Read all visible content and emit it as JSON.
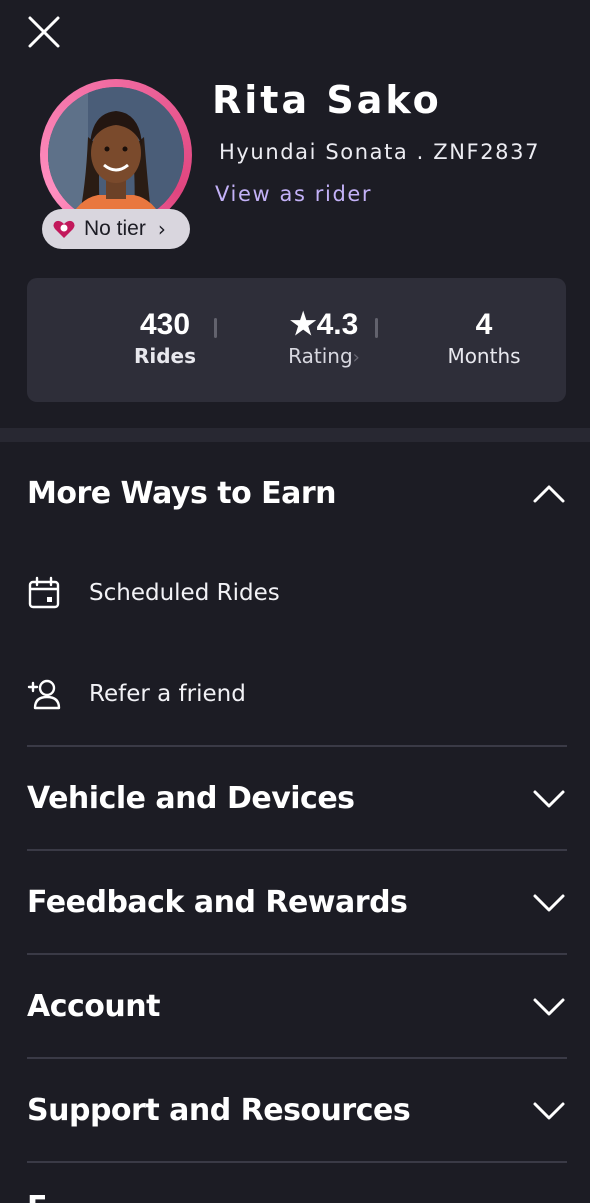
{
  "profile": {
    "name": "Rita Sako",
    "vehicle": "Hyundai Sonata . ZNF2837",
    "view_as_rider": "View as rider",
    "tier_label": "No tier",
    "tier_chevron": "›",
    "ring_color": "#f06aa0",
    "link_color": "#c3b1f7"
  },
  "stats": {
    "rides_value": "430",
    "rides_label": "Rides",
    "rating_value": "★4.3",
    "rating_label": "Rating",
    "rating_chevron": "›",
    "months_value": "4",
    "months_label": "Months"
  },
  "sections": {
    "more_ways": {
      "title": "More Ways to Earn",
      "expanded": true,
      "items": [
        {
          "label": "Scheduled Rides",
          "icon": "calendar-icon"
        },
        {
          "label": "Refer a friend",
          "icon": "add-person-icon"
        }
      ]
    },
    "vehicle_devices": {
      "title": "Vehicle and Devices",
      "expanded": false
    },
    "feedback_rewards": {
      "title": "Feedback and Rewards",
      "expanded": false
    },
    "account": {
      "title": "Account",
      "expanded": false
    },
    "support": {
      "title": "Support and Resources",
      "expanded": false
    },
    "next_cut": {
      "title": "E"
    }
  },
  "icons": {
    "close": "close-icon",
    "chevron_up": "chevron-up-icon",
    "chevron_down": "chevron-down-icon"
  },
  "colors": {
    "background": "#1c1c24",
    "card": "#2e2e39",
    "tier_pill": "#d9d6de"
  }
}
